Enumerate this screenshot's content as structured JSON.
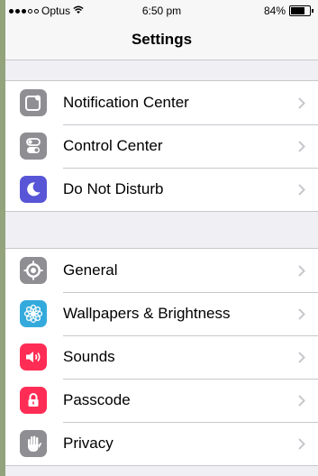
{
  "status_bar": {
    "carrier": "Optus",
    "time": "6:50 pm",
    "battery": "84%",
    "battery_level": 0.84,
    "signal_bars_filled": 3,
    "signal_bars_total": 5,
    "wifi_icon": "wifi-icon"
  },
  "nav": {
    "title": "Settings"
  },
  "groups": [
    {
      "items": [
        {
          "label": "Notification Center",
          "icon": "notification-center-icon",
          "color": "#8e8e93"
        },
        {
          "label": "Control Center",
          "icon": "control-center-icon",
          "color": "#8e8e93"
        },
        {
          "label": "Do Not Disturb",
          "icon": "moon-icon",
          "color": "#5856d6"
        }
      ]
    },
    {
      "items": [
        {
          "label": "General",
          "icon": "gear-icon",
          "color": "#8e8e93"
        },
        {
          "label": "Wallpapers & Brightness",
          "icon": "flower-icon",
          "color": "#34aadc"
        },
        {
          "label": "Sounds",
          "icon": "speaker-icon",
          "color": "#ff2d55"
        },
        {
          "label": "Passcode",
          "icon": "lock-icon",
          "color": "#ff2d55"
        },
        {
          "label": "Privacy",
          "icon": "hand-icon",
          "color": "#8e8e93"
        }
      ]
    }
  ],
  "colors": {
    "background": "#efeff4",
    "separator": "#c8c7cc",
    "chevron": "#c7c7cc"
  }
}
